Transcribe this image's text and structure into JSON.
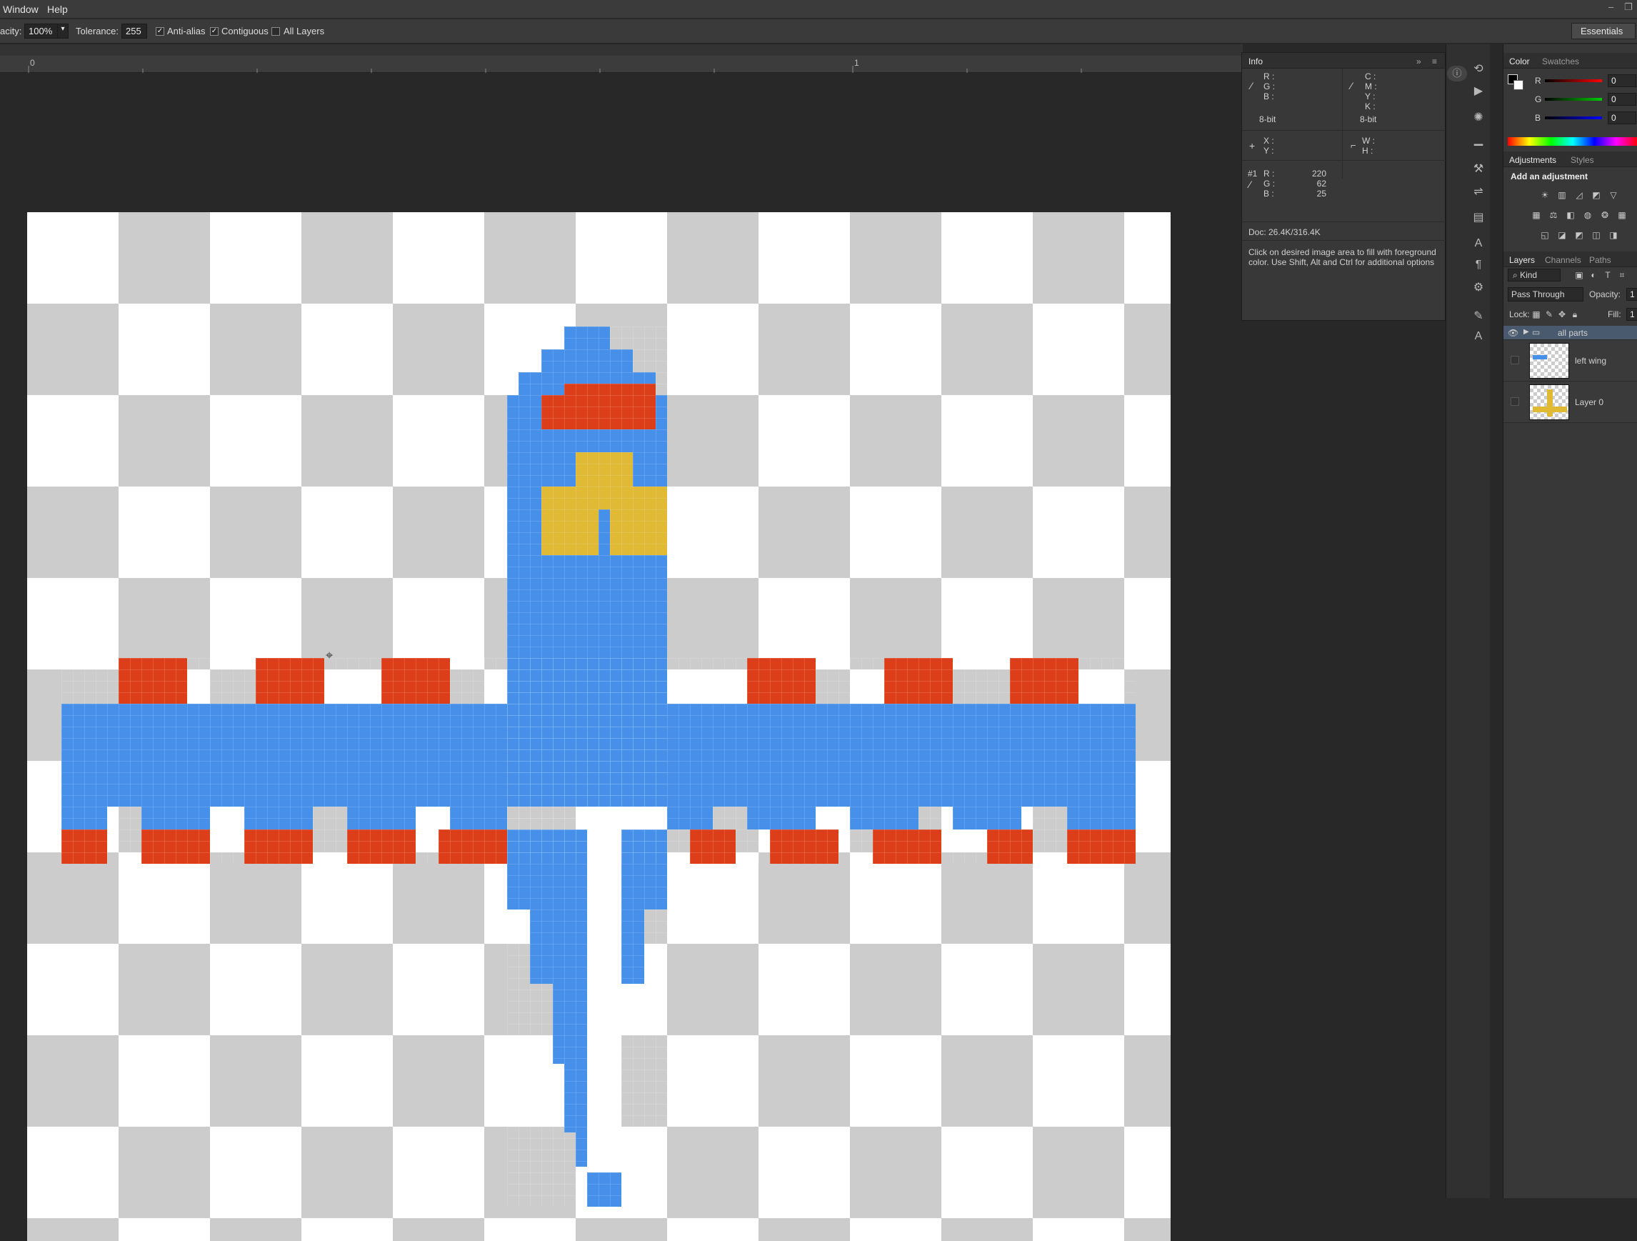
{
  "menu": {
    "items": [
      "Window",
      "Help"
    ]
  },
  "options_bar": {
    "opacity_label": "acity:",
    "opacity_value": "100%",
    "tolerance_label": "Tolerance:",
    "tolerance_value": "255",
    "anti_alias": {
      "label": "Anti-alias",
      "checked": true
    },
    "contiguous": {
      "label": "Contiguous",
      "checked": true
    },
    "all_layers": {
      "label": "All Layers",
      "checked": false
    },
    "workspace": "Essentials"
  },
  "ruler": {
    "marks": [
      "0",
      "1"
    ]
  },
  "info_panel": {
    "tab": "Info",
    "rgb_labels": [
      "R :",
      "G :",
      "B :"
    ],
    "cmyk_labels": [
      "C :",
      "M :",
      "Y :",
      "K :"
    ],
    "bit_left": "8-bit",
    "bit_right": "8-bit",
    "xy_labels": [
      "X :",
      "Y :"
    ],
    "wh_labels": [
      "W :",
      "H :"
    ],
    "sample_label": "#1",
    "sample": [
      {
        "label": "R :",
        "value": "220"
      },
      {
        "label": "G :",
        "value": "62"
      },
      {
        "label": "B :",
        "value": "25"
      }
    ],
    "doc": "Doc: 26.4K/316.4K",
    "hint": "Click on desired image area to fill with foreground color.  Use Shift, Alt and Ctrl for additional options"
  },
  "color_panel": {
    "tabs": [
      "Color",
      "Swatches"
    ],
    "channels": [
      {
        "label": "R",
        "value": "0"
      },
      {
        "label": "G",
        "value": "0"
      },
      {
        "label": "B",
        "value": "0"
      }
    ]
  },
  "adjustments_panel": {
    "tabs": [
      "Adjustments",
      "Styles"
    ],
    "heading": "Add an adjustment"
  },
  "layers_panel": {
    "tabs": [
      "Layers",
      "Channels",
      "Paths"
    ],
    "filter": "Kind",
    "blend_mode": "Pass Through",
    "opacity_label": "Opacity:",
    "opacity_value": "1",
    "lock_label": "Lock:",
    "fill_label": "Fill:",
    "fill_value": "1",
    "layers": [
      {
        "name": "all parts",
        "type": "group",
        "visible": true
      },
      {
        "name": "left wing",
        "type": "layer",
        "visible": false
      },
      {
        "name": "Layer 0",
        "type": "layer",
        "visible": false
      }
    ]
  },
  "colors": {
    "plane_blue": "#4690ea",
    "plane_red": "#dc3e19",
    "plane_yellow": "#e0b935",
    "checker_gray": "#cccccc"
  }
}
